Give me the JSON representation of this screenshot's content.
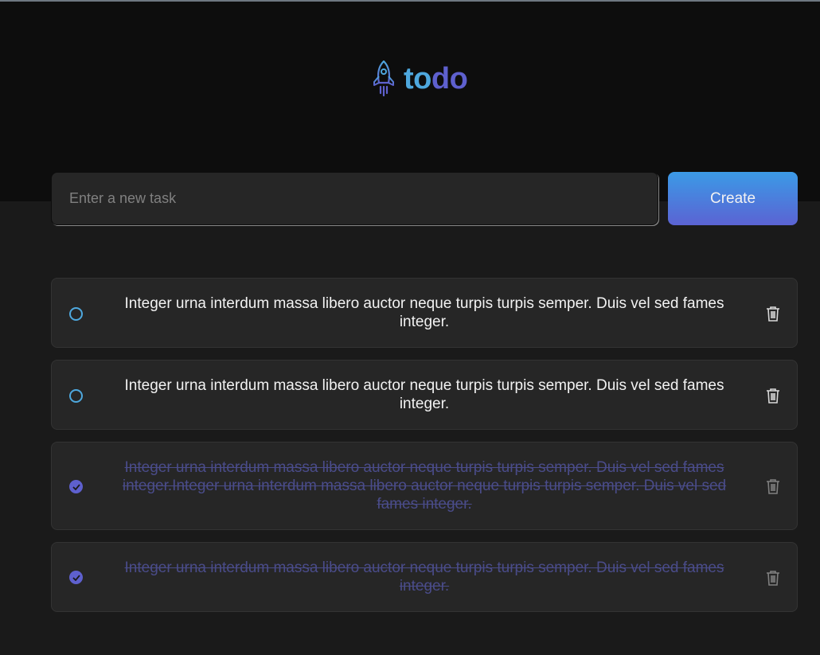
{
  "app": {
    "logo_part1": "to",
    "logo_part2": "do",
    "icon": "rocket-icon"
  },
  "form": {
    "placeholder": "Enter a new task",
    "value": "",
    "create_label": "Create"
  },
  "tasks": [
    {
      "text": "Integer urna interdum massa libero auctor neque turpis turpis semper. Duis vel sed fames integer.",
      "completed": false
    },
    {
      "text": "Integer urna interdum massa libero auctor neque turpis turpis semper. Duis vel sed fames integer.",
      "completed": false
    },
    {
      "text": "Integer urna interdum massa libero auctor neque turpis turpis semper. Duis vel sed fames integer.Integer urna interdum massa libero auctor neque turpis turpis semper. Duis vel sed fames integer.",
      "completed": true
    },
    {
      "text": "Integer urna interdum massa libero auctor neque turpis turpis semper. Duis vel sed fames integer.",
      "completed": true
    }
  ],
  "colors": {
    "accent_blue": "#4ea8de",
    "accent_purple": "#5e60ce",
    "header_bg": "#0d0d0d",
    "body_bg": "#1a1a1a",
    "card_bg": "#262626",
    "trash_open": "#d9d9d9",
    "trash_done": "#808080"
  }
}
